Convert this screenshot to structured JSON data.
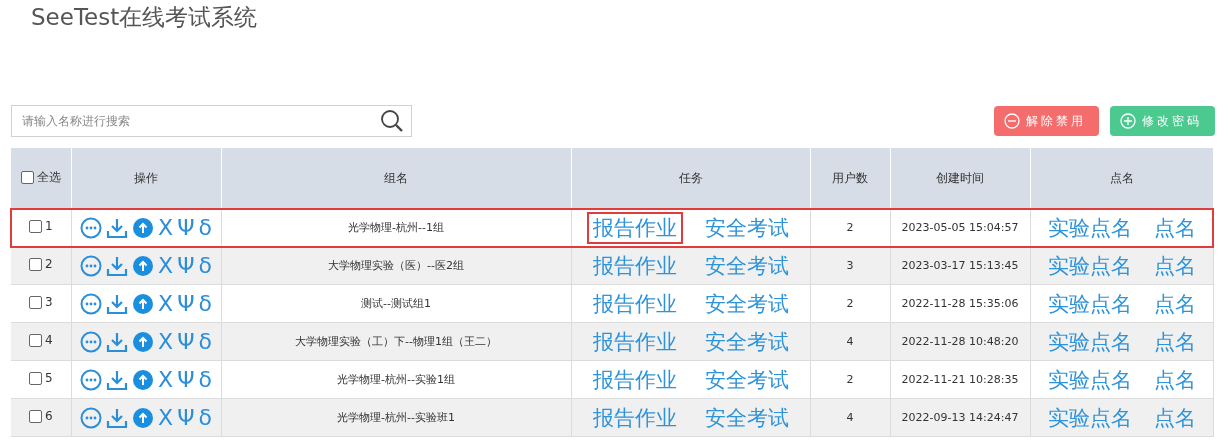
{
  "app_title": "SeeTest在线考试系统",
  "search": {
    "placeholder": "请输入名称进行搜索"
  },
  "buttons": [
    {
      "label": "解除禁用",
      "kind": "remove"
    },
    {
      "label": "修改密码",
      "kind": "add"
    }
  ],
  "table": {
    "select_all": {
      "label": "全选",
      "checked": false
    },
    "columns": [
      "操作",
      "组名",
      "任务",
      "用户数",
      "创建时间",
      "点名"
    ],
    "rows": [
      {
        "index": "1",
        "checked": false,
        "highlighted": true,
        "actions": [
          "X",
          "Ψ",
          "δ"
        ],
        "name": "光学物理-杭州--1组",
        "tasks": [
          {
            "label": "报告作业",
            "highlighted": true
          },
          {
            "label": "安全考试",
            "highlighted": false
          }
        ],
        "users": "2",
        "created": "2023-05-05 15:04:57",
        "rollcall": [
          "实验点名",
          "点名"
        ]
      },
      {
        "index": "2",
        "checked": false,
        "highlighted": false,
        "actions": [
          "X",
          "Ψ",
          "δ"
        ],
        "name": "大学物理实验（医）--医2组",
        "tasks": [
          {
            "label": "报告作业",
            "highlighted": false
          },
          {
            "label": "安全考试",
            "highlighted": false
          }
        ],
        "users": "3",
        "created": "2023-03-17 15:13:45",
        "rollcall": [
          "实验点名",
          "点名"
        ]
      },
      {
        "index": "3",
        "checked": false,
        "highlighted": false,
        "actions": [
          "X",
          "Ψ",
          "δ"
        ],
        "name": "测试--测试组1",
        "tasks": [
          {
            "label": "报告作业",
            "highlighted": false
          },
          {
            "label": "安全考试",
            "highlighted": false
          }
        ],
        "users": "2",
        "created": "2022-11-28 15:35:06",
        "rollcall": [
          "实验点名",
          "点名"
        ]
      },
      {
        "index": "4",
        "checked": false,
        "highlighted": false,
        "actions": [
          "X",
          "Ψ",
          "δ"
        ],
        "name": "大学物理实验（工）下--物理1组（王二）",
        "tasks": [
          {
            "label": "报告作业",
            "highlighted": false
          },
          {
            "label": "安全考试",
            "highlighted": false
          }
        ],
        "users": "4",
        "created": "2022-11-28 10:48:20",
        "rollcall": [
          "实验点名",
          "点名"
        ]
      },
      {
        "index": "5",
        "checked": false,
        "highlighted": false,
        "actions": [
          "X",
          "Ψ",
          "δ"
        ],
        "name": "光学物理-杭州--实验1组",
        "tasks": [
          {
            "label": "报告作业",
            "highlighted": false
          },
          {
            "label": "安全考试",
            "highlighted": false
          }
        ],
        "users": "2",
        "created": "2022-11-21 10:28:35",
        "rollcall": [
          "实验点名",
          "点名"
        ]
      },
      {
        "index": "6",
        "checked": false,
        "highlighted": false,
        "actions": [
          "X",
          "Ψ",
          "δ"
        ],
        "name": "光学物理-杭州--实验班1",
        "tasks": [
          {
            "label": "报告作业",
            "highlighted": false
          },
          {
            "label": "安全考试",
            "highlighted": false
          }
        ],
        "users": "4",
        "created": "2022-09-13 14:24:47",
        "rollcall": [
          "实验点名",
          "点名"
        ]
      }
    ]
  }
}
